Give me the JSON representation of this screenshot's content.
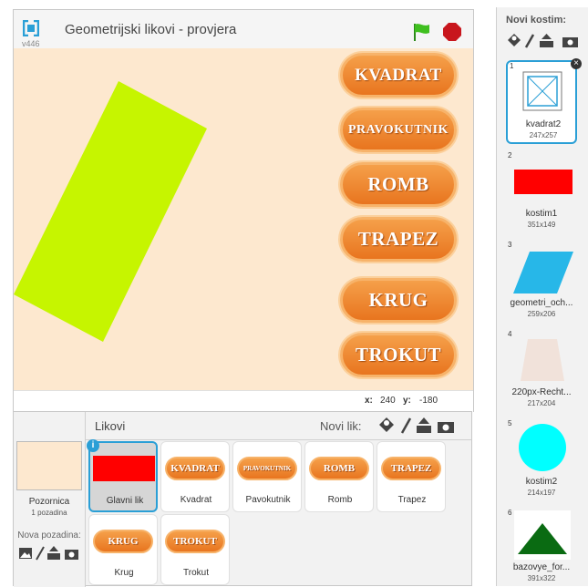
{
  "stage": {
    "version": "v446",
    "title": "Geometrijski likovi - provjera",
    "buttons": [
      "KVADRAT",
      "PRAVOKUTNIK",
      "ROMB",
      "TRAPEZ",
      "KRUG",
      "TROKUT"
    ],
    "coords": {
      "x_label": "x:",
      "x": "240",
      "y_label": "y:",
      "y": "-180"
    }
  },
  "sprites_panel": {
    "title": "Likovi",
    "new_sprite_label": "Novi lik:",
    "stage_label": "Pozornica",
    "stage_sub": "1 pozadina",
    "new_backdrop_label": "Nova pozadina:",
    "sprites": [
      {
        "name": "Glavni lik",
        "thumb": ""
      },
      {
        "name": "Kvadrat",
        "thumb": "KVADRAT"
      },
      {
        "name": "Pavokutnik",
        "thumb": "PRAVOKUTNIK"
      },
      {
        "name": "Romb",
        "thumb": "ROMB"
      },
      {
        "name": "Trapez",
        "thumb": "TRAPEZ"
      },
      {
        "name": "Krug",
        "thumb": "KRUG"
      },
      {
        "name": "Trokut",
        "thumb": "TROKUT"
      }
    ],
    "info_badge": "i"
  },
  "costumes": {
    "title": "Novi kostim:",
    "items": [
      {
        "num": "1",
        "name": "kvadrat2",
        "size": "247x257"
      },
      {
        "num": "2",
        "name": "kostim1",
        "size": "351x149"
      },
      {
        "num": "3",
        "name": "geometri_och...",
        "size": "259x206"
      },
      {
        "num": "4",
        "name": "220px-Recht...",
        "size": "217x204"
      },
      {
        "num": "5",
        "name": "kostim2",
        "size": "214x197"
      },
      {
        "num": "6",
        "name": "bazovye_for...",
        "size": "391x322"
      }
    ],
    "delete_badge": "×"
  },
  "colors": {
    "accent_blue": "#2a9fd6",
    "stage_bg": "#fde8cf",
    "shape_green": "#c6f500",
    "button_orange": "#ee8a30"
  }
}
